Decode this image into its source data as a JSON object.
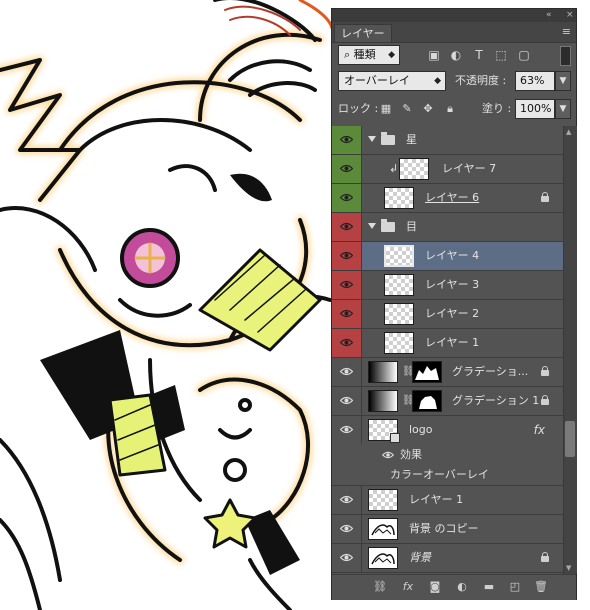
{
  "panel": {
    "collapse_icon": "«",
    "close_icon": "×",
    "tab_label": "レイヤー",
    "menu_icon": "≡"
  },
  "filter": {
    "kind_label": "種類",
    "search_icon": "⌕",
    "icons": [
      "image-filter-icon",
      "adjustment-filter-icon",
      "type-filter-icon",
      "shape-filter-icon",
      "smart-object-filter-icon"
    ]
  },
  "blend": {
    "mode": "オーバーレイ",
    "opacity_label": "不透明度 :",
    "opacity_value": "63%"
  },
  "lock": {
    "label": "ロック :",
    "fill_label": "塗り :",
    "fill_value": "100%"
  },
  "layers": [
    {
      "name": "星",
      "type": "group",
      "color": "green",
      "expanded": true
    },
    {
      "name": "レイヤー 7",
      "type": "layer",
      "color": "green",
      "clipped": true
    },
    {
      "name": "レイヤー 6",
      "type": "layer",
      "color": "green",
      "locked": true,
      "underline": true
    },
    {
      "name": "目",
      "type": "group",
      "color": "red",
      "expanded": true
    },
    {
      "name": "レイヤー 4",
      "type": "layer",
      "color": "red",
      "selected": true
    },
    {
      "name": "レイヤー 3",
      "type": "layer",
      "color": "red"
    },
    {
      "name": "レイヤー 2",
      "type": "layer",
      "color": "red"
    },
    {
      "name": "レイヤー 1",
      "type": "layer",
      "color": "red"
    },
    {
      "name": "グラデーショ...",
      "type": "gradient-fill",
      "locked": true
    },
    {
      "name": "グラデーション 1",
      "type": "gradient-fill",
      "locked": true
    },
    {
      "name": "logo",
      "type": "smart-object",
      "has_fx": true
    },
    {
      "name": "レイヤー 1",
      "type": "layer"
    },
    {
      "name": "背景 のコピー",
      "type": "image"
    },
    {
      "name": "背景",
      "type": "background",
      "locked": true
    }
  ],
  "effects": {
    "label": "効果",
    "item": "カラーオーバーレイ",
    "fx_icon": "fx"
  },
  "footer": {
    "icons": [
      "link-layers-icon",
      "fx-icon",
      "add-mask-icon",
      "adjustment-layer-icon",
      "new-group-icon",
      "new-layer-icon",
      "trash-icon"
    ]
  },
  "colors": {
    "panel_bg": "#535353",
    "label_green": "#5c8a3b",
    "label_red": "#b54142",
    "selected_row": "#5e6d86"
  }
}
